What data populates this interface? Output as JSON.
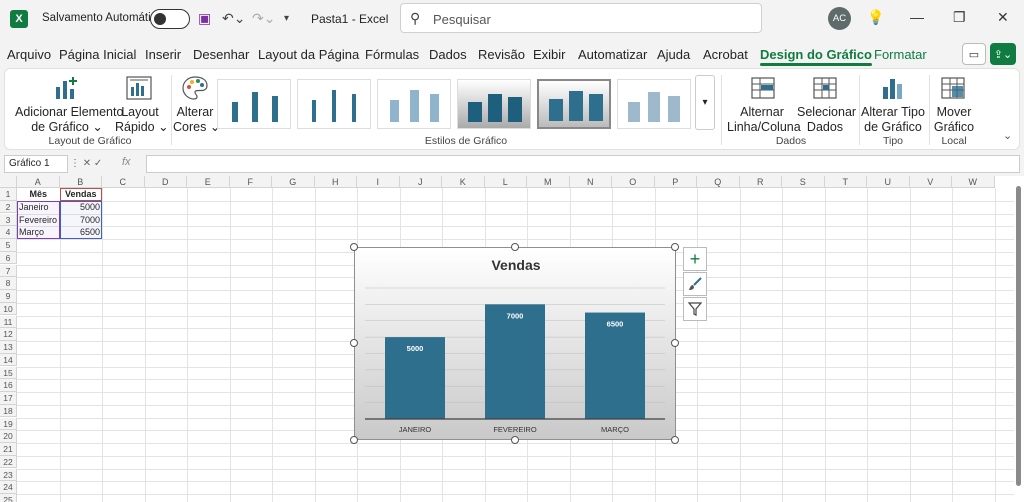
{
  "titlebar": {
    "app_logo": "X",
    "autosave_label": "Salvamento Automático",
    "doc_title": "Pasta1  -  Excel",
    "search_placeholder": "Pesquisar",
    "avatar_initials": "AC"
  },
  "tabs": [
    {
      "label": "Arquivo"
    },
    {
      "label": "Página Inicial"
    },
    {
      "label": "Inserir"
    },
    {
      "label": "Desenhar"
    },
    {
      "label": "Layout da Página"
    },
    {
      "label": "Fórmulas"
    },
    {
      "label": "Dados"
    },
    {
      "label": "Revisão"
    },
    {
      "label": "Exibir"
    },
    {
      "label": "Automatizar"
    },
    {
      "label": "Ajuda"
    },
    {
      "label": "Acrobat"
    },
    {
      "label": "Design do Gráfico"
    },
    {
      "label": "Formatar"
    }
  ],
  "ribbon": {
    "add_element_l1": "Adicionar Elemento",
    "add_element_l2": "de Gráfico ⌄",
    "quick_layout_l1": "Layout",
    "quick_layout_l2": "Rápido ⌄",
    "group_layout": "Layout de Gráfico",
    "change_colors_l1": "Alterar",
    "change_colors_l2": "Cores ⌄",
    "group_styles": "Estilos de Gráfico",
    "switch_l1": "Alternar",
    "switch_l2": "Linha/Coluna",
    "select_l1": "Selecionar",
    "select_l2": "Dados",
    "group_data": "Dados",
    "change_type_l1": "Alterar Tipo",
    "change_type_l2": "de Gráfico",
    "group_type": "Tipo",
    "move_l1": "Mover",
    "move_l2": "Gráfico",
    "group_location": "Local"
  },
  "formula": {
    "name_box": "Gráfico 1",
    "fx": "fx"
  },
  "columns": [
    "A",
    "B",
    "C",
    "D",
    "E",
    "F",
    "G",
    "H",
    "I",
    "J",
    "K",
    "L",
    "M",
    "N",
    "O",
    "P",
    "Q",
    "R",
    "S",
    "T",
    "U",
    "V",
    "W"
  ],
  "rows": [
    "1",
    "2",
    "3",
    "4",
    "5",
    "6",
    "7",
    "8",
    "9",
    "10",
    "11",
    "12",
    "13",
    "14",
    "15",
    "16",
    "17",
    "18",
    "19",
    "20",
    "21",
    "22",
    "23",
    "24",
    "25"
  ],
  "table": {
    "headers": [
      "Mês",
      "Vendas"
    ],
    "rows": [
      {
        "month": "Janeiro",
        "value": "5000"
      },
      {
        "month": "Fevereiro",
        "value": "7000"
      },
      {
        "month": "Março",
        "value": "6500"
      }
    ]
  },
  "chart_data": {
    "type": "bar",
    "title": "Vendas",
    "categories": [
      "JANEIRO",
      "FEVEREIRO",
      "MARÇO"
    ],
    "values": [
      5000,
      7000,
      6500
    ],
    "data_labels": [
      "5000",
      "7000",
      "6500"
    ],
    "ylim": [
      0,
      8000
    ],
    "grid": true,
    "bar_color": "#2e6f8e"
  },
  "colors": {
    "accent": "#107c41"
  }
}
